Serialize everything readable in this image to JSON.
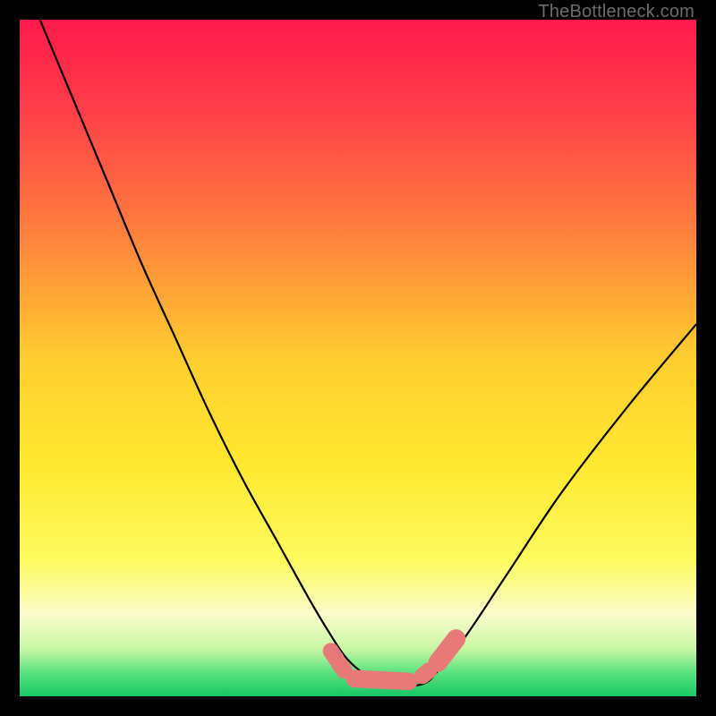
{
  "watermark": "TheBottleneck.com",
  "chart_data": {
    "type": "line",
    "title": "",
    "xlabel": "",
    "ylabel": "",
    "xlim": [
      0,
      100
    ],
    "ylim": [
      0,
      100
    ],
    "grid": false,
    "legend": false,
    "gradient_stops": [
      {
        "offset": 0.0,
        "color": "#ff1a4b"
      },
      {
        "offset": 0.12,
        "color": "#ff3a4a"
      },
      {
        "offset": 0.3,
        "color": "#ff7a3e"
      },
      {
        "offset": 0.5,
        "color": "#ffcd2f"
      },
      {
        "offset": 0.66,
        "color": "#ffe92f"
      },
      {
        "offset": 0.8,
        "color": "#fdfb60"
      },
      {
        "offset": 0.88,
        "color": "#fbfccc"
      },
      {
        "offset": 0.93,
        "color": "#c7f7a3"
      },
      {
        "offset": 0.965,
        "color": "#5ae27e"
      },
      {
        "offset": 1.0,
        "color": "#17c765"
      }
    ],
    "series": [
      {
        "name": "bottleneck-curve",
        "color": "#000000",
        "x": [
          3,
          8,
          13,
          18,
          23,
          28,
          33,
          38,
          43,
          46,
          48,
          50,
          53,
          57,
          60,
          62,
          66,
          72,
          80,
          90,
          100
        ],
        "y": [
          100,
          88,
          76,
          64,
          53,
          42,
          32,
          23,
          14,
          9,
          6,
          4,
          2,
          1.5,
          2,
          4,
          9,
          18,
          30,
          43,
          55
        ]
      }
    ],
    "markers": {
      "color": "#e77a77",
      "capsules": [
        {
          "x1": 46.0,
          "y1": 6.7,
          "x2": 46.8,
          "y2": 5.5,
          "r": 1.2
        },
        {
          "x1": 47.2,
          "y1": 4.8,
          "x2": 48.0,
          "y2": 3.8,
          "r": 1.2
        },
        {
          "x1": 49.5,
          "y1": 2.6,
          "x2": 57.5,
          "y2": 2.2,
          "r": 1.3
        },
        {
          "x1": 59.5,
          "y1": 3.0,
          "x2": 60.5,
          "y2": 3.8,
          "r": 1.2
        },
        {
          "x1": 61.8,
          "y1": 5.0,
          "x2": 64.5,
          "y2": 8.5,
          "r": 1.4
        }
      ]
    }
  }
}
